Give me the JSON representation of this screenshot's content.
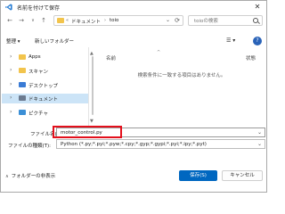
{
  "window": {
    "title": "名前を付けて保存"
  },
  "address": {
    "segments": [
      "ドキュメント",
      "toio"
    ],
    "sep": "›",
    "lead": "«"
  },
  "search": {
    "placeholder": "toioの検索"
  },
  "commands": {
    "organize": "整理 ▾",
    "new_folder": "新しいフォルダー"
  },
  "nav": {
    "items": [
      {
        "label": "Apps",
        "icon": "folder-icon",
        "color": "#f2c44c",
        "selected": false
      },
      {
        "label": "スキャン",
        "icon": "folder-icon",
        "color": "#f2c44c",
        "selected": false
      },
      {
        "label": "デスクトップ",
        "icon": "desktop-icon",
        "color": "#3a7bd5",
        "selected": false
      },
      {
        "label": "ドキュメント",
        "icon": "documents-icon",
        "color": "#6b7a8f",
        "selected": true
      },
      {
        "label": "ピクチャ",
        "icon": "pictures-icon",
        "color": "#3b8fd6",
        "selected": false
      }
    ]
  },
  "filelist": {
    "columns": {
      "name": "名前",
      "status": "状態"
    },
    "empty_message": "検索条件に一致する項目はありません。"
  },
  "form": {
    "filename_label": "ファイル名(N):",
    "filename_value": "motor_control.py",
    "filetype_label": "ファイルの種類(T):",
    "filetype_value": "Python (*.py;*.pyi;*.pyw;*.cpy;*.gyp;*.gypi;*.pyi;*.ipy;*.pyt)"
  },
  "footer": {
    "hide_folders": "フォルダーの非表示",
    "save": "保存(S)",
    "cancel": "キャンセル"
  },
  "colors": {
    "accent": "#0067c0",
    "highlight": "#e3101c",
    "selected": "#cce4f7"
  }
}
